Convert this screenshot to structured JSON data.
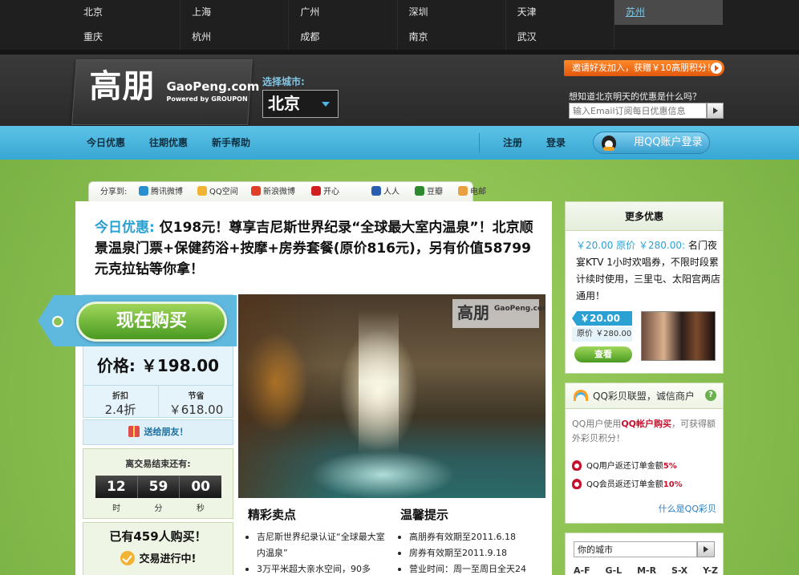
{
  "cities": [
    {
      "name": "北京",
      "active": false
    },
    {
      "name": "上海",
      "active": false
    },
    {
      "name": "广州",
      "active": false
    },
    {
      "name": "深圳",
      "active": false
    },
    {
      "name": "天津",
      "active": false
    },
    {
      "name": "苏州",
      "active": true
    },
    {
      "name": "重庆",
      "active": false
    },
    {
      "name": "杭州",
      "active": false
    },
    {
      "name": "成都",
      "active": false
    },
    {
      "name": "南京",
      "active": false
    },
    {
      "name": "武汉",
      "active": false
    },
    {
      "name": "",
      "active": false
    }
  ],
  "header": {
    "logo_cn": "高朋",
    "logo_en": "GaoPeng.com",
    "logo_sub": "Powered by GROUPON",
    "city_label": "选择城市:",
    "city_selected": "北京",
    "invite": "邀请好友加入，获赠￥10高朋积分！",
    "subscribe_question": "想知道北京明天的优惠是什么吗？",
    "subscribe_placeholder": "输入Email订阅每日优惠信息"
  },
  "nav": {
    "today": "今日优惠",
    "past": "往期优惠",
    "help": "新手帮助",
    "register": "注册",
    "login": "登录",
    "qq_login": "用QQ账户登录"
  },
  "share": {
    "label": "分享到:",
    "items": [
      {
        "label": "腾讯微博",
        "color": "#2a8fd0"
      },
      {
        "label": "QQ空间",
        "color": "#f2b233"
      },
      {
        "label": "新浪微博",
        "color": "#e0402a"
      },
      {
        "label": "开心",
        "color": "#d02020"
      },
      {
        "label": "人人",
        "color": "#2a5fb0"
      },
      {
        "label": "豆瓣",
        "color": "#2f8a2f"
      },
      {
        "label": "电邮",
        "color": "#e8a040"
      }
    ]
  },
  "deal": {
    "tag": "今日优惠:",
    "title": "仅198元！尊享吉尼斯世界纪录“全球最大室内温泉”！北京顺景温泉门票+保健药浴+按摩+房券套餐(原价816元)，另有价值58799元克拉钻等你拿！",
    "buy_label": "现在购买",
    "price_label": "价格:",
    "price_value": "￥198.00",
    "discount_label": "折扣",
    "discount_value": "2.4折",
    "save_label": "节省",
    "save_value": "￥618.00",
    "gift": "送给朋友！",
    "timer_label": "离交易结束还有:",
    "timer": {
      "hours": "12",
      "minutes": "59",
      "seconds": "00"
    },
    "timer_units": {
      "hours": "时",
      "minutes": "分",
      "seconds": "秒"
    },
    "sold": "已有459人购买！",
    "status": "交易进行中!",
    "image_watermark_cn": "高朋",
    "image_watermark_en": "GaoPeng.com",
    "highlights_title": "精彩卖点",
    "highlights": [
      "吉尼斯世界纪录认证“全球最大室内温泉”",
      "3万平米超大亲水空间，90多"
    ],
    "tips_title": "温馨提示",
    "tips": [
      "高朋券有效期至2011.6.18",
      "房券有效期至2011.9.18",
      "营业时间：周一至周日全天24"
    ]
  },
  "more": {
    "title": "更多优惠",
    "desc_price": "￥20.00 原价 ￥280.00:",
    "desc_text": " 名门夜宴KTV 1小时欢唱券，不限时段累计续时使用，三里屯、太阳宫两店通用！",
    "price": "￥20.00",
    "orig_label": "原价",
    "orig_value": "￥280.00",
    "view": "查看"
  },
  "caipiao": {
    "title": "QQ彩贝联盟，诚信商户",
    "desc_a": "QQ用户使用",
    "desc_red": "QQ帐户购买",
    "desc_b": "，可获得额外彩贝积分！",
    "rebate1_text": "QQ用户返还订单金额",
    "rebate1_pct": "5%",
    "rebate2_text": "QQ会员返还订单金额",
    "rebate2_pct": "10%",
    "link": "什么是QQ彩贝"
  },
  "your_city": {
    "value": "你的城市",
    "letters": [
      "A-F",
      "G-L",
      "M-R",
      "S-X",
      "Y-Z"
    ]
  }
}
